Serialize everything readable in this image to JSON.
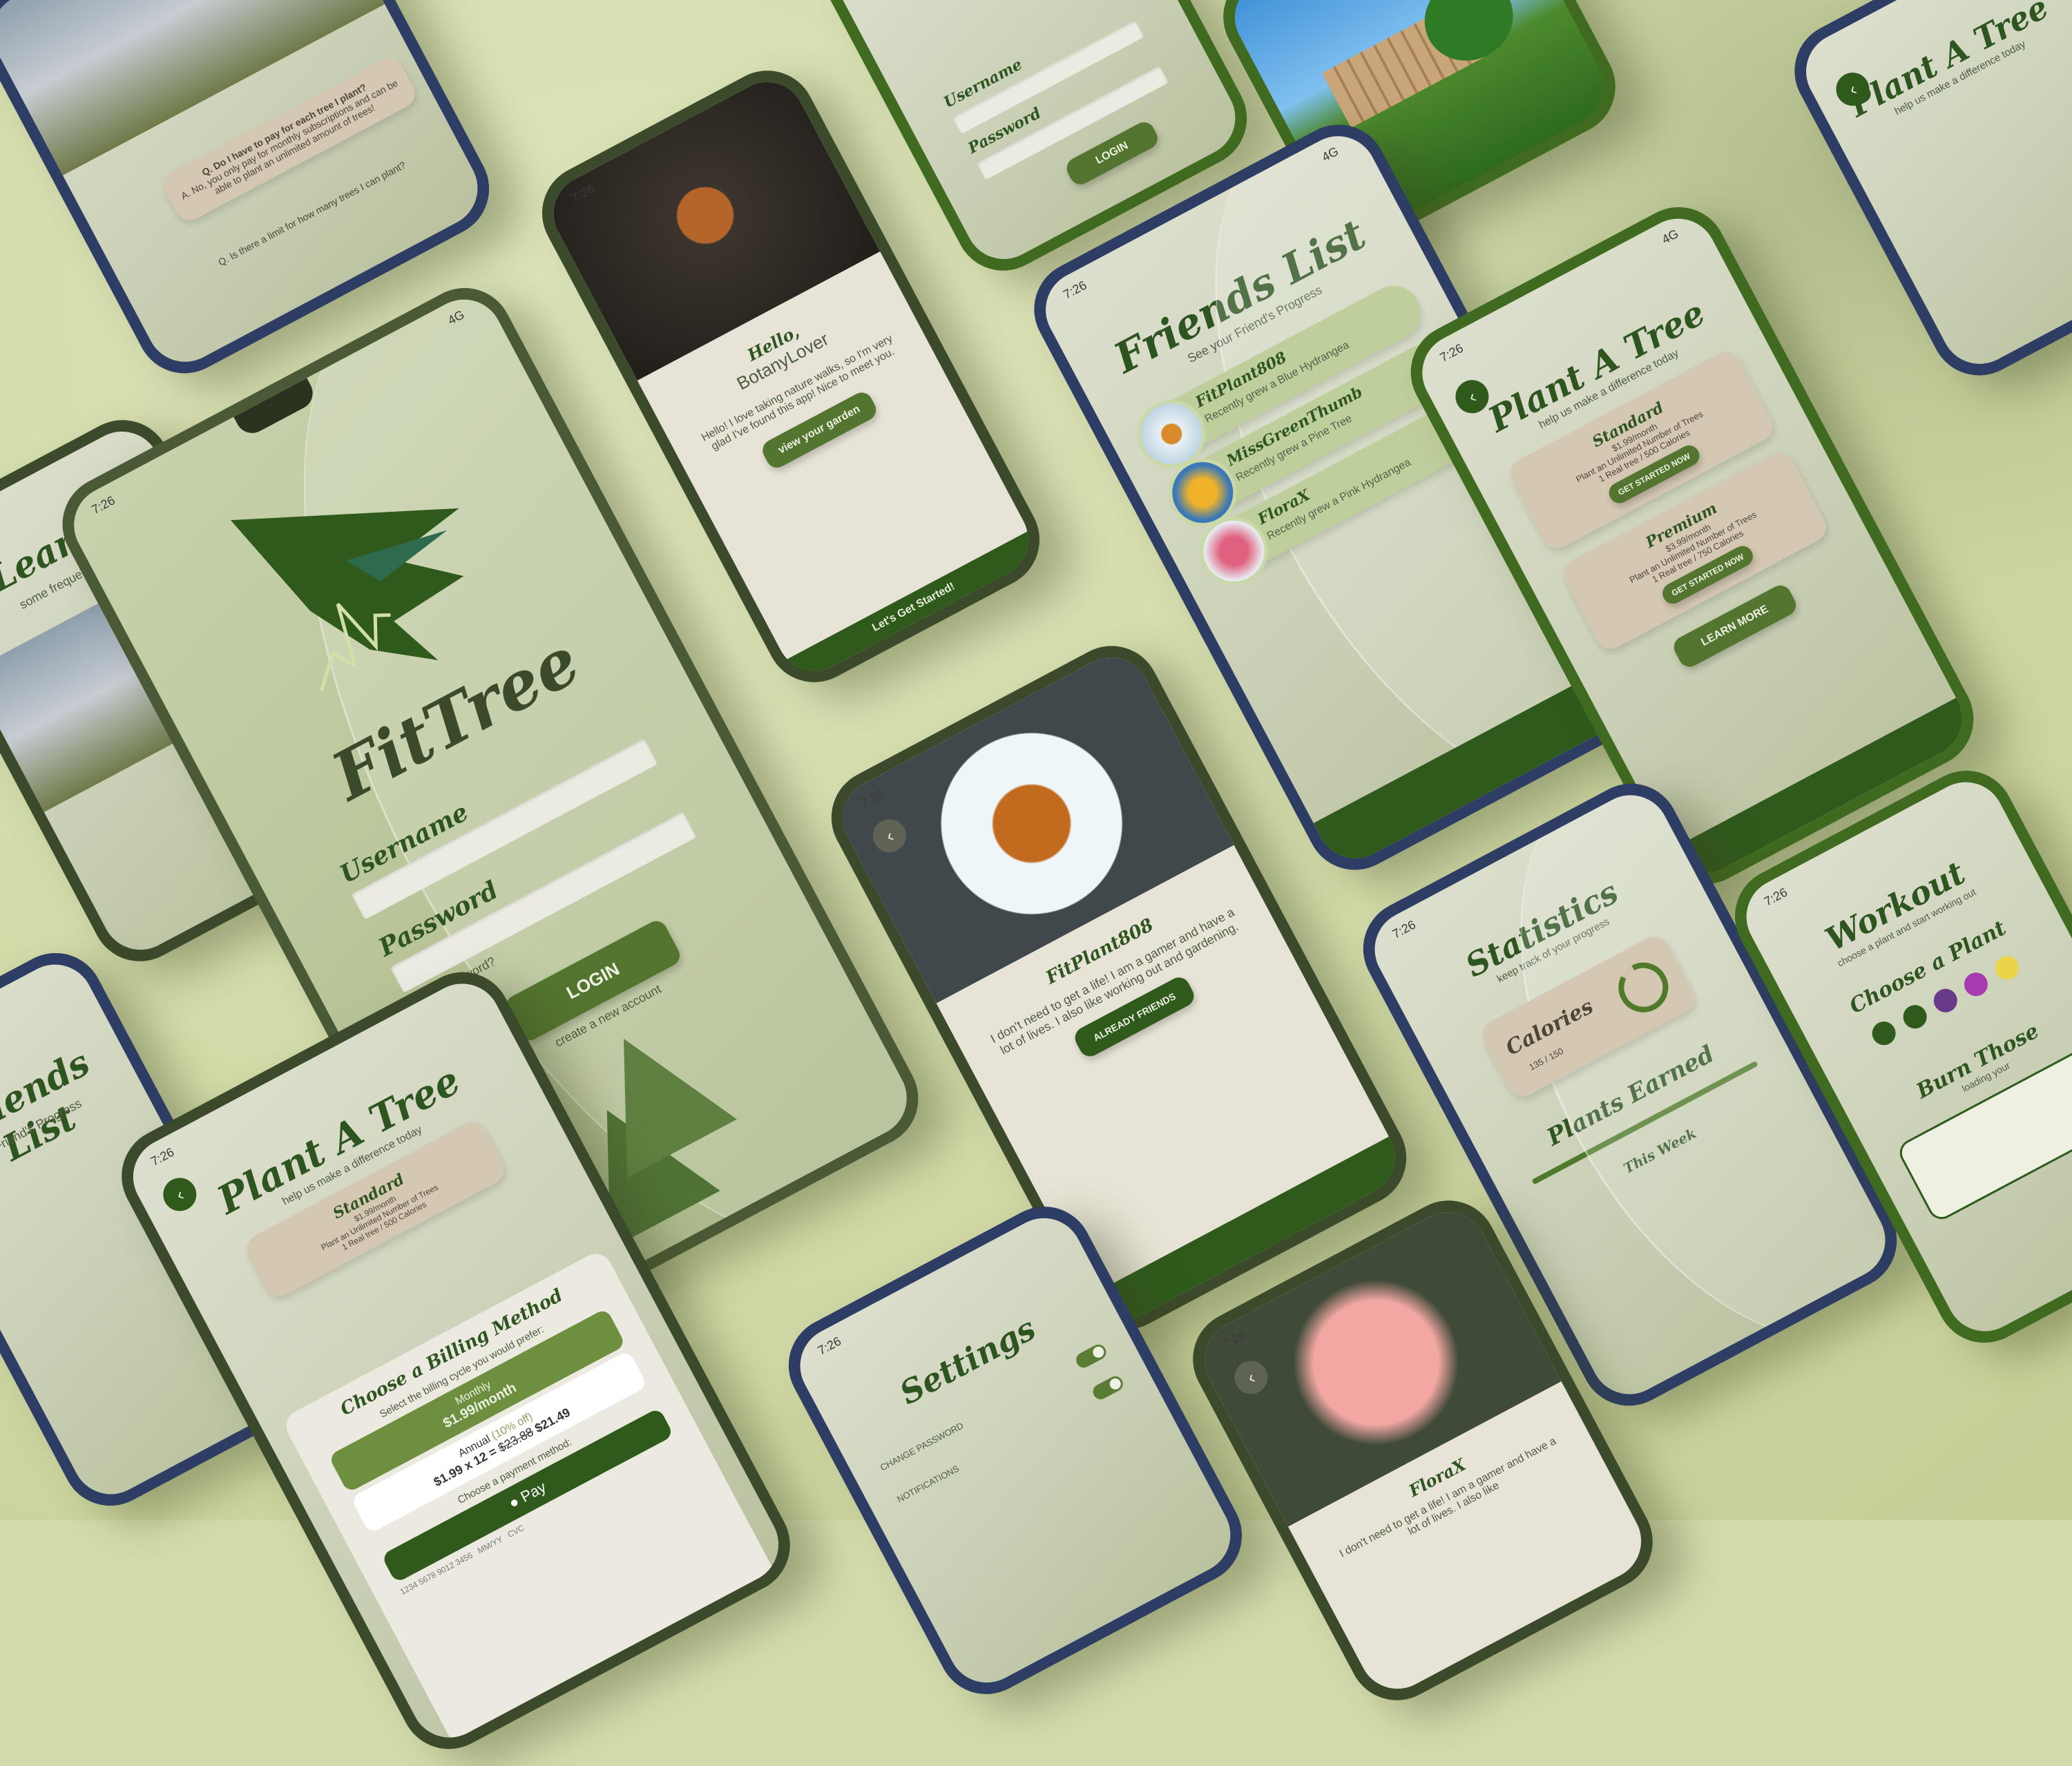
{
  "status": {
    "time": "7:26",
    "network": "4G"
  },
  "login": {
    "app_name": "FitTree",
    "username_label": "Username",
    "password_label": "Password",
    "forgot_label": "forgot password?",
    "login_button": "LOGIN",
    "create_label": "create a new account"
  },
  "welcome": {
    "greeting": "Hello,",
    "user": "BotanyLover",
    "message": "Hello! I love taking nature walks, so I'm very glad I've found this app! Nice to meet you.",
    "garden_button": "view your garden",
    "start_label": "Let's Get Started!"
  },
  "friends": {
    "title": "Friends List",
    "subtitle": "See your Friend's Progress",
    "items": [
      {
        "name": "FitPlant808",
        "activity": "Recently grew a Blue Hydrangea"
      },
      {
        "name": "MissGreenThumb",
        "activity": "Recently grew a Pine Tree"
      },
      {
        "name": "FloraX",
        "activity": "Recently grew a Pink Hydrangea"
      }
    ]
  },
  "plant": {
    "title": "Plant A Tree",
    "subtitle": "help us make a difference today",
    "plans": [
      {
        "name": "Standard",
        "price": "$1.99/month",
        "desc": "Plant an Unlimited Number of Trees",
        "detail": "1 Real tree / 500 Calories",
        "button": "GET STARTED NOW"
      },
      {
        "name": "Premium",
        "price": "$3.99/month",
        "desc": "Plant an Unlimited Number of Trees",
        "detail": "1 Real tree / 750 Calories",
        "button": "GET STARTED NOW"
      }
    ],
    "learn_button": "LEARN MORE"
  },
  "profile": {
    "name": "FitPlant808",
    "bio": "I don't need to get a life! I am a gamer and have a lot of lives. I also like working out and gardening.",
    "button": "ALREADY FRIENDS"
  },
  "stats": {
    "title": "Statistics",
    "subtitle": "keep track of your progress",
    "calories_label": "Calories",
    "calories_value": "135 / 150",
    "calories_fraction": 0.9,
    "plants_title": "Plants Earned",
    "week_label": "This Week"
  },
  "workout": {
    "title": "Workout",
    "subtitle": "choose a plant and start working out",
    "choose": "Choose a Plant",
    "burn": "Burn Those",
    "loading": "loading your"
  },
  "settings": {
    "title": "Settings",
    "change_password": "CHANGE PASSWORD",
    "notifications": "NOTIFICATIONS"
  },
  "billing": {
    "title": "Choose a Billing Method",
    "prompt": "Select the billing cycle you would prefer:",
    "monthly": "Monthly",
    "monthly_price": "$1.99/month",
    "annual": "Annual",
    "annual_off": "(10% off)",
    "annual_calc": "$1.99 x 12 =",
    "annual_old": "$23.88",
    "annual_new": "$21.49",
    "payment_prompt": "Choose a payment method:",
    "pay": "Pay",
    "card_number": "1234 5678 9012 3456",
    "expiry": "MM/YY",
    "cvc": "CVC"
  },
  "learn": {
    "title": "Learn",
    "subtitle": "some frequently asked questions",
    "q1": "Q. Do I have to pay for each tree I plant?",
    "a1": "A. No, you only pay for monthly subscriptions and can be able to plant an unlimited amount of trees!",
    "q2": "Q. Is there a limit for how many trees I can plant?"
  },
  "rose_profile": {
    "name": "FloraX",
    "bio": "I don't need to get a life! I am a gamer and have a lot of lives. I also like"
  },
  "colors": {
    "background": "#d3dbac",
    "accent": "#2f5a1c",
    "card": "#d4c8b2"
  }
}
